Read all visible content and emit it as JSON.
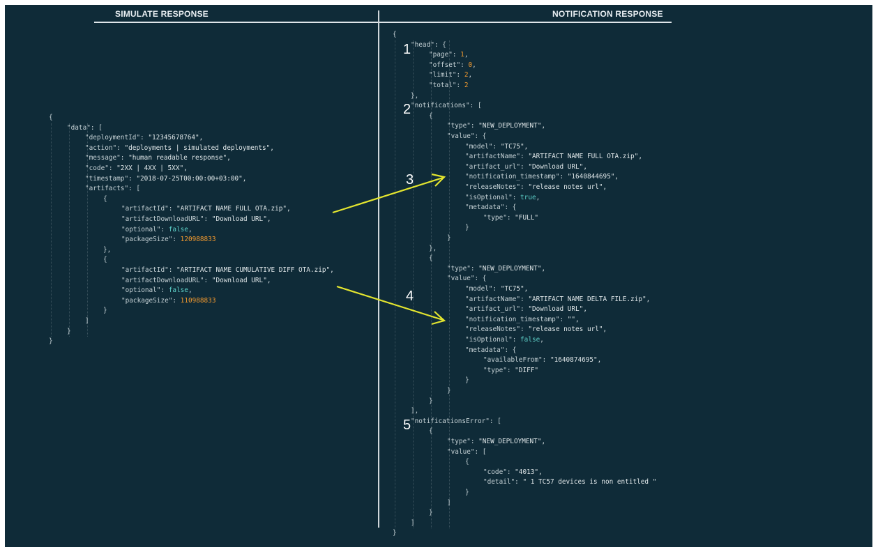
{
  "headers": {
    "left": "SIMULATE RESPONSE",
    "right": "NOTIFICATION RESPONSE"
  },
  "markers": [
    "1",
    "2",
    "3",
    "4",
    "5"
  ],
  "colors": {
    "background": "#0f2b38",
    "number": "#f2992e",
    "boolean": "#5ed0c8",
    "arrow": "#e4e62f"
  },
  "left_code": [
    {
      "i": 0,
      "parts": [
        {
          "t": "{",
          "c": "k"
        }
      ]
    },
    {
      "i": 1,
      "parts": [
        {
          "t": "\"data\": [",
          "c": "k"
        }
      ]
    },
    {
      "i": 2,
      "parts": [
        {
          "t": "\"deploymentId\": ",
          "c": "k"
        },
        {
          "t": "\"12345678764\",",
          "c": "s"
        }
      ]
    },
    {
      "i": 2,
      "parts": [
        {
          "t": "\"action\": ",
          "c": "k"
        },
        {
          "t": "\"deployments | simulated deployments\",",
          "c": "s"
        }
      ]
    },
    {
      "i": 2,
      "parts": [
        {
          "t": "\"message\": ",
          "c": "k"
        },
        {
          "t": "\"human readable response\",",
          "c": "s"
        }
      ]
    },
    {
      "i": 2,
      "parts": [
        {
          "t": "\"code\": ",
          "c": "k"
        },
        {
          "t": "\"2XX | 4XX | 5XX\",",
          "c": "s"
        }
      ]
    },
    {
      "i": 2,
      "parts": [
        {
          "t": "\"timestamp\": ",
          "c": "k"
        },
        {
          "t": "\"2018-07-25T00:00:00+03:00\",",
          "c": "s"
        }
      ]
    },
    {
      "i": 2,
      "parts": [
        {
          "t": "\"artifacts\": [",
          "c": "k"
        }
      ]
    },
    {
      "i": 3,
      "parts": [
        {
          "t": "{",
          "c": "k"
        }
      ]
    },
    {
      "i": 4,
      "parts": [
        {
          "t": "\"artifactId\": ",
          "c": "k"
        },
        {
          "t": "\"ARTIFACT NAME FULL OTA.zip\",",
          "c": "s"
        }
      ]
    },
    {
      "i": 4,
      "parts": [
        {
          "t": "\"artifactDownloadURL\": ",
          "c": "k"
        },
        {
          "t": "\"Download URL\",",
          "c": "s"
        }
      ]
    },
    {
      "i": 4,
      "parts": [
        {
          "t": "\"optional\": ",
          "c": "k"
        },
        {
          "t": "false",
          "c": "b"
        },
        {
          "t": ",",
          "c": "k"
        }
      ]
    },
    {
      "i": 4,
      "parts": [
        {
          "t": "\"packageSize\": ",
          "c": "k"
        },
        {
          "t": "120988833",
          "c": "n"
        }
      ]
    },
    {
      "i": 3,
      "parts": [
        {
          "t": "},",
          "c": "k"
        }
      ]
    },
    {
      "i": 3,
      "parts": [
        {
          "t": "{",
          "c": "k"
        }
      ]
    },
    {
      "i": 4,
      "parts": [
        {
          "t": "\"artifactId\": ",
          "c": "k"
        },
        {
          "t": "\"ARTIFACT NAME CUMULATIVE DIFF OTA.zip\",",
          "c": "s"
        }
      ]
    },
    {
      "i": 4,
      "parts": [
        {
          "t": "\"artifactDownloadURL\": ",
          "c": "k"
        },
        {
          "t": "\"Download URL\",",
          "c": "s"
        }
      ]
    },
    {
      "i": 4,
      "parts": [
        {
          "t": "\"optional\": ",
          "c": "k"
        },
        {
          "t": "false",
          "c": "b"
        },
        {
          "t": ",",
          "c": "k"
        }
      ]
    },
    {
      "i": 4,
      "parts": [
        {
          "t": "\"packageSize\": ",
          "c": "k"
        },
        {
          "t": "110988833",
          "c": "n"
        }
      ]
    },
    {
      "i": 3,
      "parts": [
        {
          "t": "}",
          "c": "k"
        }
      ]
    },
    {
      "i": 2,
      "parts": [
        {
          "t": "]",
          "c": "k"
        }
      ]
    },
    {
      "i": 1,
      "parts": [
        {
          "t": "}",
          "c": "k"
        }
      ]
    },
    {
      "i": 0,
      "parts": [
        {
          "t": "}",
          "c": "k"
        }
      ]
    }
  ],
  "right_code": [
    {
      "i": 0,
      "parts": [
        {
          "t": "{",
          "c": "k"
        }
      ]
    },
    {
      "i": 1,
      "parts": [
        {
          "t": "\"head\": {",
          "c": "k"
        }
      ]
    },
    {
      "i": 2,
      "parts": [
        {
          "t": "\"page\": ",
          "c": "k"
        },
        {
          "t": "1",
          "c": "n"
        },
        {
          "t": ",",
          "c": "k"
        }
      ]
    },
    {
      "i": 2,
      "parts": [
        {
          "t": "\"offset\": ",
          "c": "k"
        },
        {
          "t": "0",
          "c": "n"
        },
        {
          "t": ",",
          "c": "k"
        }
      ]
    },
    {
      "i": 2,
      "parts": [
        {
          "t": "\"limit\": ",
          "c": "k"
        },
        {
          "t": "2",
          "c": "n"
        },
        {
          "t": ",",
          "c": "k"
        }
      ]
    },
    {
      "i": 2,
      "parts": [
        {
          "t": "\"total\": ",
          "c": "k"
        },
        {
          "t": "2",
          "c": "n"
        }
      ]
    },
    {
      "i": 1,
      "parts": [
        {
          "t": "},",
          "c": "k"
        }
      ]
    },
    {
      "i": 1,
      "parts": [
        {
          "t": "\"notifications\": [",
          "c": "k"
        }
      ]
    },
    {
      "i": 2,
      "parts": [
        {
          "t": "{",
          "c": "k"
        }
      ]
    },
    {
      "i": 3,
      "parts": [
        {
          "t": "\"type\": ",
          "c": "k"
        },
        {
          "t": "\"NEW_DEPLOYMENT\",",
          "c": "s"
        }
      ]
    },
    {
      "i": 3,
      "parts": [
        {
          "t": "\"value\": {",
          "c": "k"
        }
      ]
    },
    {
      "i": 4,
      "parts": [
        {
          "t": "\"model\": ",
          "c": "k"
        },
        {
          "t": "\"TC75\",",
          "c": "s"
        }
      ]
    },
    {
      "i": 4,
      "parts": [
        {
          "t": "\"artifactName\": ",
          "c": "k"
        },
        {
          "t": "\"ARTIFACT NAME FULL OTA.zip\",",
          "c": "s"
        }
      ]
    },
    {
      "i": 4,
      "parts": [
        {
          "t": "\"artifact_url\": ",
          "c": "k"
        },
        {
          "t": "\"Download URL\",",
          "c": "s"
        }
      ]
    },
    {
      "i": 4,
      "parts": [
        {
          "t": "\"notification_timestamp\": ",
          "c": "k"
        },
        {
          "t": "\"1640844695\",",
          "c": "s"
        }
      ]
    },
    {
      "i": 4,
      "parts": [
        {
          "t": "\"releaseNotes\": ",
          "c": "k"
        },
        {
          "t": "\"release notes url\",",
          "c": "s"
        }
      ]
    },
    {
      "i": 4,
      "parts": [
        {
          "t": "\"isOptional\": ",
          "c": "k"
        },
        {
          "t": "true",
          "c": "b"
        },
        {
          "t": ",",
          "c": "k"
        }
      ]
    },
    {
      "i": 4,
      "parts": [
        {
          "t": "\"metadata\": {",
          "c": "k"
        }
      ]
    },
    {
      "i": 5,
      "parts": [
        {
          "t": "\"type\": ",
          "c": "k"
        },
        {
          "t": "\"FULL\"",
          "c": "s"
        }
      ]
    },
    {
      "i": 4,
      "parts": [
        {
          "t": "}",
          "c": "k"
        }
      ]
    },
    {
      "i": 3,
      "parts": [
        {
          "t": "}",
          "c": "k"
        }
      ]
    },
    {
      "i": 2,
      "parts": [
        {
          "t": "},",
          "c": "k"
        }
      ]
    },
    {
      "i": 2,
      "parts": [
        {
          "t": "{",
          "c": "k"
        }
      ]
    },
    {
      "i": 3,
      "parts": [
        {
          "t": "\"type\": ",
          "c": "k"
        },
        {
          "t": "\"NEW_DEPLOYMENT\",",
          "c": "s"
        }
      ]
    },
    {
      "i": 3,
      "parts": [
        {
          "t": "\"value\": {",
          "c": "k"
        }
      ]
    },
    {
      "i": 4,
      "parts": [
        {
          "t": "\"model\": ",
          "c": "k"
        },
        {
          "t": "\"TC75\",",
          "c": "s"
        }
      ]
    },
    {
      "i": 4,
      "parts": [
        {
          "t": "\"artifactName\": ",
          "c": "k"
        },
        {
          "t": "\"ARTIFACT NAME DELTA FILE.zip\",",
          "c": "s"
        }
      ]
    },
    {
      "i": 4,
      "parts": [
        {
          "t": "\"artifact_url\": ",
          "c": "k"
        },
        {
          "t": "\"Download URL\",",
          "c": "s"
        }
      ]
    },
    {
      "i": 4,
      "parts": [
        {
          "t": "\"notification_timestamp\": ",
          "c": "k"
        },
        {
          "t": "\"\",",
          "c": "s"
        }
      ]
    },
    {
      "i": 4,
      "parts": [
        {
          "t": "\"releaseNotes\": ",
          "c": "k"
        },
        {
          "t": "\"release notes url\",",
          "c": "s"
        }
      ]
    },
    {
      "i": 4,
      "parts": [
        {
          "t": "\"isOptional\": ",
          "c": "k"
        },
        {
          "t": "false",
          "c": "b"
        },
        {
          "t": ",",
          "c": "k"
        }
      ]
    },
    {
      "i": 4,
      "parts": [
        {
          "t": "\"metadata\": {",
          "c": "k"
        }
      ]
    },
    {
      "i": 5,
      "parts": [
        {
          "t": "\"availableFrom\": ",
          "c": "k"
        },
        {
          "t": "\"1640874695\",",
          "c": "s"
        }
      ]
    },
    {
      "i": 5,
      "parts": [
        {
          "t": "\"type\": ",
          "c": "k"
        },
        {
          "t": "\"DIFF\"",
          "c": "s"
        }
      ]
    },
    {
      "i": 4,
      "parts": [
        {
          "t": "}",
          "c": "k"
        }
      ]
    },
    {
      "i": 3,
      "parts": [
        {
          "t": "}",
          "c": "k"
        }
      ]
    },
    {
      "i": 2,
      "parts": [
        {
          "t": "}",
          "c": "k"
        }
      ]
    },
    {
      "i": 1,
      "parts": [
        {
          "t": "],",
          "c": "k"
        }
      ]
    },
    {
      "i": 1,
      "parts": [
        {
          "t": "\"notificationsError\": [",
          "c": "k"
        }
      ]
    },
    {
      "i": 2,
      "parts": [
        {
          "t": "{",
          "c": "k"
        }
      ]
    },
    {
      "i": 3,
      "parts": [
        {
          "t": "\"type\": ",
          "c": "k"
        },
        {
          "t": "\"NEW_DEPLOYMENT\",",
          "c": "s"
        }
      ]
    },
    {
      "i": 3,
      "parts": [
        {
          "t": "\"value\": [",
          "c": "k"
        }
      ]
    },
    {
      "i": 4,
      "parts": [
        {
          "t": "{",
          "c": "k"
        }
      ]
    },
    {
      "i": 5,
      "parts": [
        {
          "t": "\"code\": ",
          "c": "k"
        },
        {
          "t": "\"4013\",",
          "c": "s"
        }
      ]
    },
    {
      "i": 5,
      "parts": [
        {
          "t": "\"detail\": ",
          "c": "k"
        },
        {
          "t": "\" 1 TC57 devices is non entitled \"",
          "c": "s"
        }
      ]
    },
    {
      "i": 4,
      "parts": [
        {
          "t": "}",
          "c": "k"
        }
      ]
    },
    {
      "i": 3,
      "parts": [
        {
          "t": "]",
          "c": "k"
        }
      ]
    },
    {
      "i": 2,
      "parts": [
        {
          "t": "}",
          "c": "k"
        }
      ]
    },
    {
      "i": 1,
      "parts": [
        {
          "t": "]",
          "c": "k"
        }
      ]
    },
    {
      "i": 0,
      "parts": [
        {
          "t": "}",
          "c": "k"
        }
      ]
    }
  ]
}
